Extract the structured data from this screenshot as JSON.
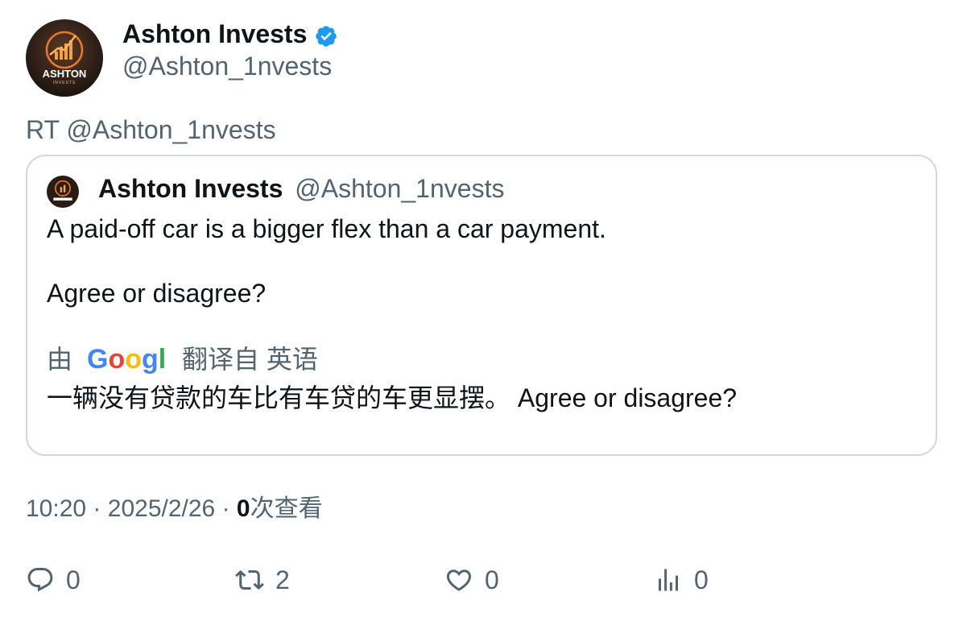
{
  "author": {
    "name": "Ashton Invests",
    "handle": "@Ashton_1nvests",
    "avatar_text": "ASHTON",
    "avatar_subtext": "INVESTS",
    "verified": true
  },
  "retweet_line": "RT @Ashton_1nvests",
  "quote": {
    "author_name": "Ashton Invests",
    "author_handle": "@Ashton_1nvests",
    "text_line1": "A paid-off car is a bigger flex than a car payment.",
    "text_line2": "Agree or disagree?",
    "translated_by_prefix": "由",
    "translated_by_suffix": "翻译自 英语",
    "translated_text": "一辆没有贷款的车比有车贷的车更显摆。 Agree or disagree?"
  },
  "meta": {
    "time": "10:20",
    "separator": "·",
    "date": "2025/2/26",
    "views_count": "0",
    "views_label": "次查看"
  },
  "actions": {
    "replies": "0",
    "retweets": "2",
    "likes": "0",
    "views": "0"
  },
  "colors": {
    "text_primary": "#0f1419",
    "text_secondary": "#536471",
    "border": "#cfd9de",
    "verified_blue": "#1d9bf0",
    "avatar_orange": "#e8782a"
  },
  "icons": [
    "verified-badge-icon",
    "google-logo",
    "reply-icon",
    "retweet-icon",
    "like-icon",
    "views-icon"
  ]
}
